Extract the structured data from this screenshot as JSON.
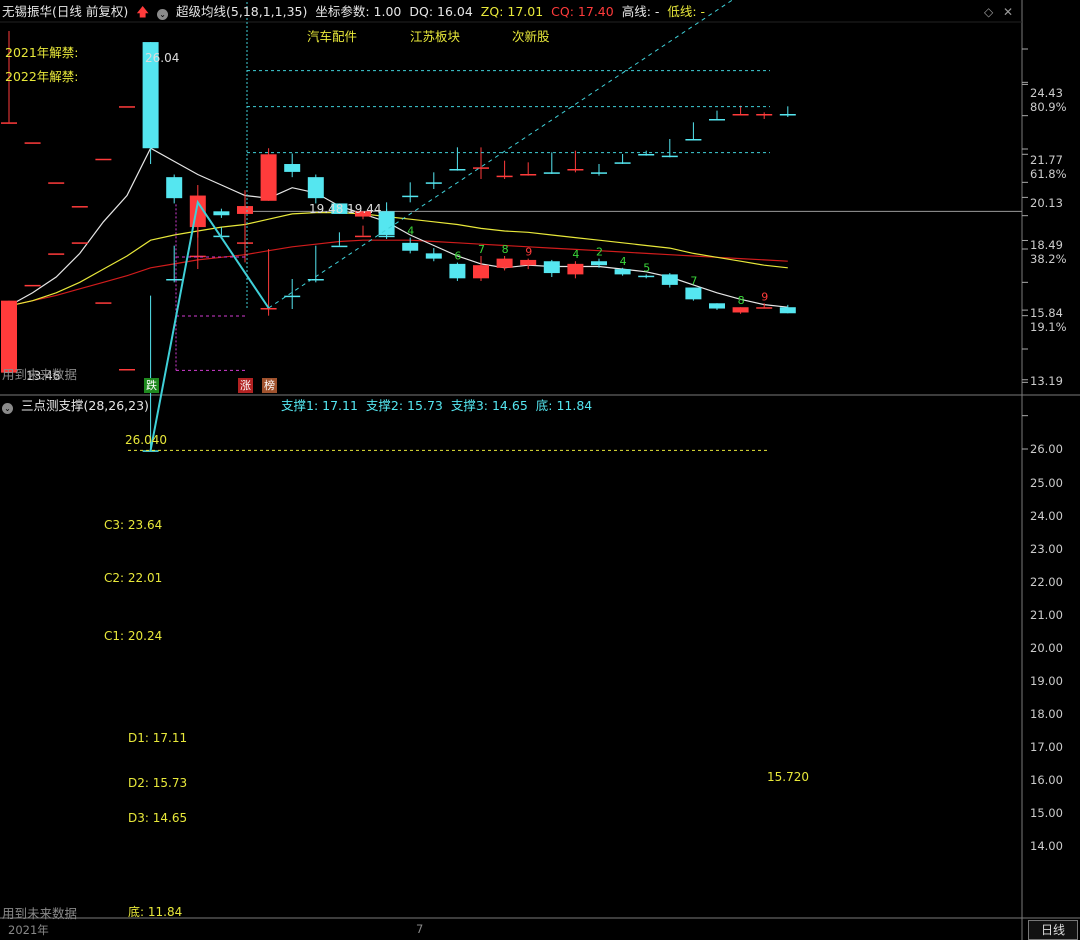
{
  "header": {
    "stock_name": "无锡振华(日线 前复权)",
    "ma_name": "超级均线(5,18,1,1,35)",
    "coord_label": "坐标参数: 1.00",
    "dq": "DQ: 16.04",
    "zq": "ZQ: 17.01",
    "cq": "CQ: 17.40",
    "high_line": "高线: -",
    "low_line": "低线: -"
  },
  "sectors": [
    "汽车配件",
    "江苏板块",
    "次新股"
  ],
  "bans": [
    "2021年解禁:",
    "2022年解禁:"
  ],
  "main_axis": [
    {
      "value": "24.43",
      "color": "#cccccc"
    },
    {
      "value": "80.9%",
      "color": "#cccccc"
    },
    {
      "value": "21.77",
      "color": "#cccccc"
    },
    {
      "value": "61.8%",
      "color": "#cccccc"
    },
    {
      "value": "20.13",
      "color": "#cccccc"
    },
    {
      "value": "18.49",
      "color": "#cccccc"
    },
    {
      "value": "38.2%",
      "color": "#cccccc"
    },
    {
      "value": "15.84",
      "color": "#cccccc"
    },
    {
      "value": "19.1%",
      "color": "#cccccc"
    },
    {
      "value": "13.19",
      "color": "#cccccc"
    }
  ],
  "main_labels": {
    "high": "26.04",
    "low": "13.46",
    "ma_values": "19.48 19.44",
    "future": "用到未来数据"
  },
  "tags": [
    {
      "text": "跌",
      "bg": "#1f8a1f"
    },
    {
      "text": "涨",
      "bg": "#b22222"
    },
    {
      "text": "榜",
      "bg": "#a0522d"
    }
  ],
  "counts": [
    {
      "text": "4",
      "color": "#3ad63a"
    },
    {
      "text": "6",
      "color": "#3ad63a"
    },
    {
      "text": "7",
      "color": "#3ad63a"
    },
    {
      "text": "8",
      "color": "#3ad63a"
    },
    {
      "text": "9",
      "color": "#ff3b3b"
    },
    {
      "text": "4",
      "color": "#3ad63a"
    },
    {
      "text": "2",
      "color": "#3ad63a"
    },
    {
      "text": "4",
      "color": "#3ad63a"
    },
    {
      "text": "5",
      "color": "#3ad63a"
    },
    {
      "text": "7",
      "color": "#3ad63a"
    },
    {
      "text": "8",
      "color": "#3ad63a"
    },
    {
      "text": "9",
      "color": "#ff3b3b"
    }
  ],
  "sub": {
    "title": "三点测支撑(28,26,23)",
    "support1": "支撑1: 17.11",
    "support2": "支撑2: 15.73",
    "support3": "支撑3: 14.65",
    "bottom": "底: 11.84",
    "top_label": "26.040",
    "c3": "C3: 23.64",
    "c2": "C2: 22.01",
    "c1": "C1: 20.24",
    "d1": "D1: 17.11",
    "d2": "D2: 15.73",
    "d3": "D3: 14.65",
    "di": "底: 11.84",
    "last_price": "15.720",
    "future": "用到未来数据"
  },
  "sub_axis": [
    "26.00",
    "25.00",
    "24.00",
    "23.00",
    "22.00",
    "21.00",
    "20.00",
    "19.00",
    "18.00",
    "17.00",
    "16.00",
    "15.00",
    "14.00"
  ],
  "bottom_bar": {
    "year": "2021年",
    "month": "7",
    "tab": "日线"
  },
  "colors": {
    "up": "#ff3b3b",
    "down": "#55e6f0",
    "ma_fast": "#e6e6e6",
    "ma_mid": "#e8e83a",
    "ma_slow": "#d01c1c",
    "grid": "#3a3a3a",
    "magenta": "#d23cd2"
  },
  "chart_data": {
    "type": "candlestick",
    "note_panels": [
      "main",
      "sub"
    ],
    "candles": [
      {
        "o": 13.46,
        "h": 16.2,
        "l": 13.46,
        "c": 16.2
      },
      {
        "o": 16.8,
        "h": 16.8,
        "l": 16.8,
        "c": 16.8
      },
      {
        "o": 18.0,
        "h": 18.0,
        "l": 18.0,
        "c": 18.0
      },
      {
        "o": 19.8,
        "h": 19.8,
        "l": 19.8,
        "c": 19.8
      },
      {
        "o": 21.6,
        "h": 21.6,
        "l": 21.6,
        "c": 21.6
      },
      {
        "o": 23.6,
        "h": 23.6,
        "l": 23.6,
        "c": 23.6
      },
      {
        "o": 26.04,
        "h": 26.04,
        "l": 21.4,
        "c": 22.0
      },
      {
        "o": 20.9,
        "h": 21.0,
        "l": 19.9,
        "c": 20.1
      },
      {
        "o": 19.0,
        "h": 20.6,
        "l": 18.6,
        "c": 20.2
      },
      {
        "o": 19.6,
        "h": 19.7,
        "l": 19.35,
        "c": 19.45
      },
      {
        "o": 19.5,
        "h": 20.4,
        "l": 18.9,
        "c": 19.8
      },
      {
        "o": 20.0,
        "h": 22.0,
        "l": 20.0,
        "c": 21.77
      },
      {
        "o": 21.4,
        "h": 21.8,
        "l": 20.9,
        "c": 21.1
      },
      {
        "o": 20.9,
        "h": 21.0,
        "l": 19.9,
        "c": 20.1
      },
      {
        "o": 19.9,
        "h": 19.9,
        "l": 19.5,
        "c": 19.5
      },
      {
        "o": 19.4,
        "h": 19.6,
        "l": 19.3,
        "c": 19.6
      },
      {
        "o": 19.6,
        "h": 19.7,
        "l": 18.6,
        "c": 18.7
      },
      {
        "o": 18.4,
        "h": 18.6,
        "l": 18.0,
        "c": 18.1
      },
      {
        "o": 18.0,
        "h": 18.2,
        "l": 17.7,
        "c": 17.8
      },
      {
        "o": 17.6,
        "h": 17.65,
        "l": 16.95,
        "c": 17.05
      },
      {
        "o": 17.05,
        "h": 17.9,
        "l": 16.95,
        "c": 17.55
      },
      {
        "o": 17.45,
        "h": 17.9,
        "l": 17.35,
        "c": 17.8
      },
      {
        "o": 17.55,
        "h": 17.8,
        "l": 17.4,
        "c": 17.75
      },
      {
        "o": 17.7,
        "h": 17.75,
        "l": 17.1,
        "c": 17.25
      },
      {
        "o": 17.2,
        "h": 17.7,
        "l": 17.05,
        "c": 17.6
      },
      {
        "o": 17.7,
        "h": 17.8,
        "l": 17.45,
        "c": 17.55
      },
      {
        "o": 17.4,
        "h": 17.45,
        "l": 17.15,
        "c": 17.2
      },
      {
        "o": 17.15,
        "h": 17.2,
        "l": 17.05,
        "c": 17.1
      },
      {
        "o": 17.2,
        "h": 17.25,
        "l": 16.7,
        "c": 16.8
      },
      {
        "o": 16.7,
        "h": 16.7,
        "l": 16.2,
        "c": 16.25
      },
      {
        "o": 16.1,
        "h": 16.1,
        "l": 15.85,
        "c": 15.9
      },
      {
        "o": 15.75,
        "h": 15.95,
        "l": 15.7,
        "c": 15.95
      },
      {
        "o": 15.95,
        "h": 16.1,
        "l": 15.9,
        "c": 15.95
      },
      {
        "o": 15.95,
        "h": 16.04,
        "l": 15.72,
        "c": 15.72
      }
    ],
    "ma_fast": [
      16.0,
      16.5,
      17.1,
      18.0,
      19.2,
      20.2,
      22.0,
      21.5,
      21.0,
      20.6,
      20.2,
      20.1,
      20.5,
      20.3,
      19.8,
      19.5,
      19.2,
      18.7,
      18.3,
      17.9,
      17.6,
      17.45,
      17.55,
      17.5,
      17.5,
      17.5,
      17.4,
      17.3,
      17.1,
      16.8,
      16.5,
      16.25,
      16.05,
      15.95
    ],
    "ma_mid": [
      16.0,
      16.2,
      16.5,
      16.9,
      17.4,
      17.9,
      18.5,
      18.7,
      18.85,
      19.0,
      19.1,
      19.3,
      19.5,
      19.55,
      19.55,
      19.5,
      19.4,
      19.3,
      19.2,
      19.1,
      18.95,
      18.85,
      18.8,
      18.7,
      18.6,
      18.5,
      18.4,
      18.3,
      18.2,
      18.0,
      17.85,
      17.7,
      17.55,
      17.45
    ],
    "ma_slow": [
      16.0,
      16.2,
      16.4,
      16.65,
      16.9,
      17.15,
      17.45,
      17.6,
      17.75,
      17.85,
      17.95,
      18.1,
      18.25,
      18.35,
      18.45,
      18.5,
      18.5,
      18.5,
      18.45,
      18.4,
      18.35,
      18.3,
      18.25,
      18.2,
      18.15,
      18.1,
      18.05,
      18.0,
      17.95,
      17.9,
      17.85,
      17.8,
      17.75,
      17.7
    ],
    "zigzag": [
      [
        6,
        26.04
      ],
      [
        8,
        18.6
      ],
      [
        11,
        21.77
      ]
    ],
    "c_levels": [
      23.64,
      22.01,
      20.24
    ],
    "d_levels": [
      17.11,
      15.73,
      14.65
    ],
    "bottom": 11.84,
    "top": 26.04
  }
}
